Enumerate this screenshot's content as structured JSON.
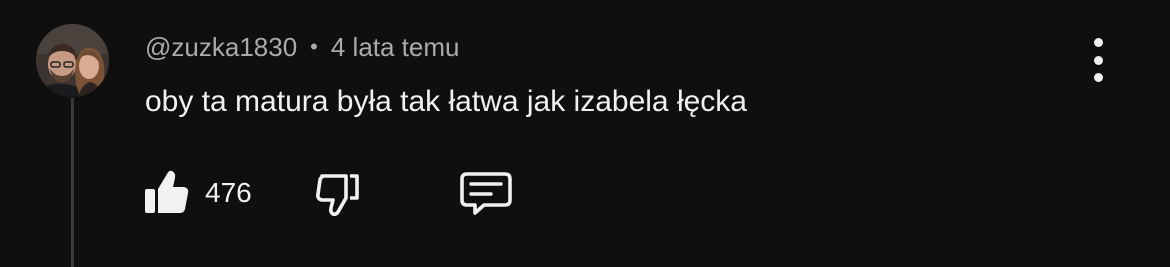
{
  "comment": {
    "author": "@zuzka1830",
    "separator": "•",
    "timestamp": "4 lata temu",
    "text": "oby ta matura była tak łatwa jak izabela łęcka",
    "like_count": "476",
    "avatar_alt": "avatar"
  },
  "icons": {
    "like": "thumbs-up-icon",
    "dislike": "thumbs-down-icon",
    "reply": "comment-reply-icon",
    "menu": "vertical-dots-icon"
  },
  "colors": {
    "background": "#0f0f0f",
    "primary_text": "#f1f1f1",
    "secondary_text": "#aaaaaa",
    "thread_line": "#3a3a3a"
  }
}
